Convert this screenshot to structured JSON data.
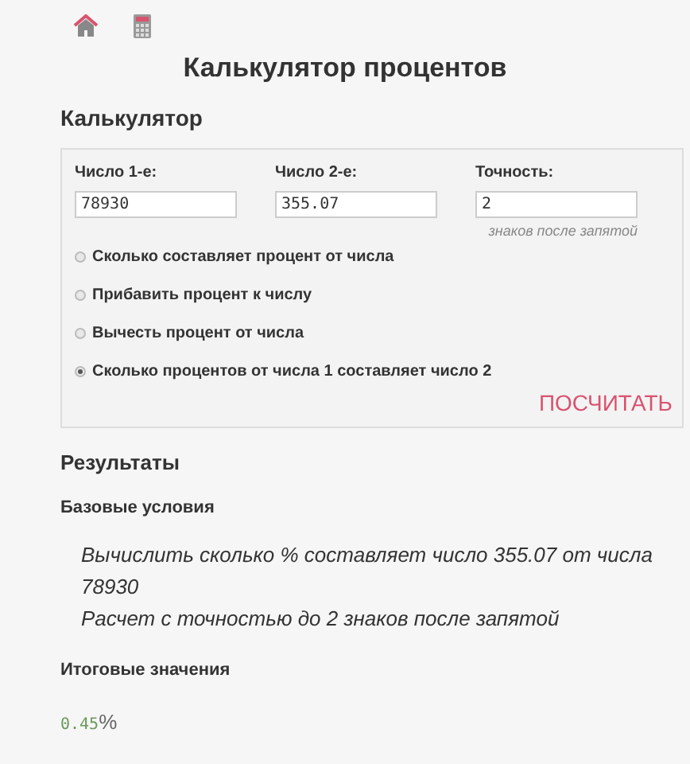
{
  "nav": [
    {
      "kind": "home"
    },
    {
      "kind": "calculator"
    }
  ],
  "title": "Калькулятор процентов",
  "calculator": {
    "heading": "Калькулятор",
    "fields": [
      {
        "label": "Число 1-е:",
        "value": "78930"
      },
      {
        "label": "Число 2-е:",
        "value": "355.07"
      },
      {
        "label": "Точность:",
        "value": "2",
        "hint": "знаков после запятой"
      }
    ],
    "options": [
      {
        "label": "Сколько составляет процент от числа",
        "selected": false
      },
      {
        "label": "Прибавить процент к числу",
        "selected": false
      },
      {
        "label": "Вычесть процент от числа",
        "selected": false
      },
      {
        "label": "Сколько процентов от числа 1 составляет число 2",
        "selected": true
      }
    ],
    "button": "ПОСЧИТАТЬ"
  },
  "results": {
    "heading": "Результаты",
    "conditions_heading": "Базовые условия",
    "conditions": [
      "Вычислить сколько % составляет число 355.07 от числа 78930",
      "Расчет с точностью до 2 знаков после запятой"
    ],
    "totals_heading": "Итоговые значения",
    "value": "0.45",
    "unit": "%"
  }
}
